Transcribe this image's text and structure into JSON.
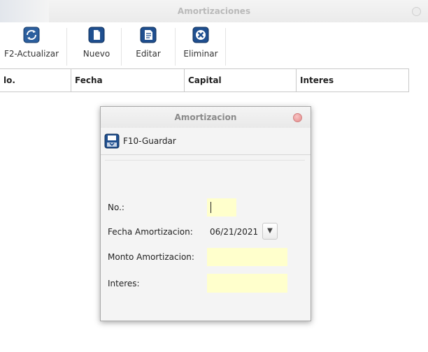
{
  "main_window": {
    "title": "Amortizaciones"
  },
  "toolbar": {
    "buttons": [
      {
        "label": "F2-Actualizar",
        "icon": "refresh-icon"
      },
      {
        "label": "Nuevo",
        "icon": "new-document-icon"
      },
      {
        "label": "Editar",
        "icon": "edit-icon"
      },
      {
        "label": "Eliminar",
        "icon": "delete-icon"
      }
    ]
  },
  "table": {
    "columns": [
      "lo.",
      "Fecha",
      "Capital",
      "Interes"
    ]
  },
  "dialog": {
    "title": "Amortizacion",
    "save_label": "F10-Guardar",
    "fields": {
      "no_label": "No.:",
      "no_value": "",
      "fecha_label": "Fecha Amortizacion:",
      "fecha_value": "06/21/2021",
      "monto_label": "Monto Amortizacion:",
      "monto_value": "",
      "interes_label": "Interes:",
      "interes_value": ""
    }
  },
  "colors": {
    "field_bg": "#ffffcc",
    "icon_blue": "#1f4f8f",
    "close_red": "#e48989"
  }
}
